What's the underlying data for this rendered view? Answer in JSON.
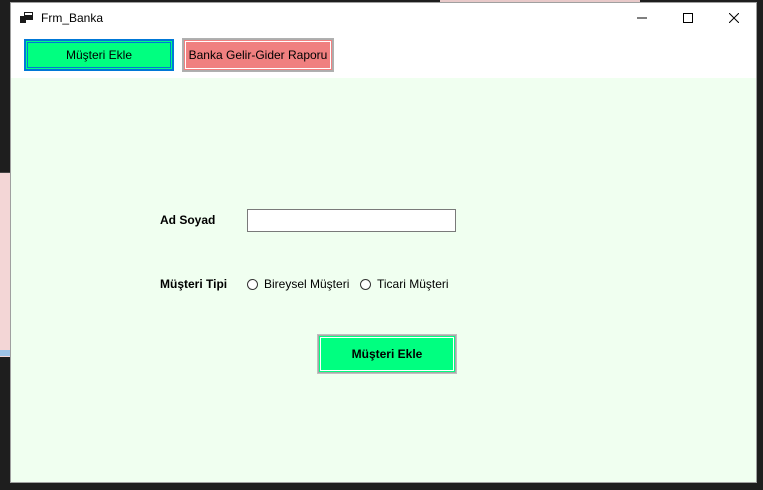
{
  "window": {
    "title": "Frm_Banka",
    "controls": {
      "minimize": "—",
      "maximize": "☐",
      "close": "✕"
    }
  },
  "toolbar": {
    "customer_tab_label": "Müşteri Ekle",
    "report_tab_label": "Banka Gelir-Gider Raporu"
  },
  "form": {
    "name_label": "Ad Soyad",
    "name_value": "",
    "type_label": "Müşteri Tipi",
    "type_options": [
      "Bireysel Müşteri",
      "Ticari Müşteri"
    ],
    "submit_label": "Müşteri Ekle"
  },
  "colors": {
    "accent_green": "#00ff80",
    "report_button": "#f08080",
    "content_background": "#f0fff0"
  }
}
